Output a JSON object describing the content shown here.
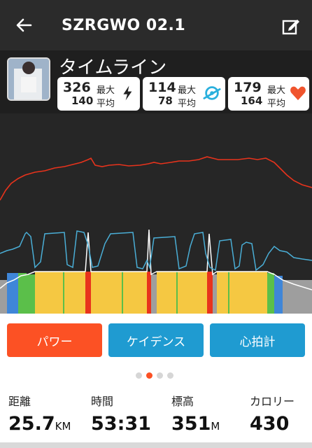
{
  "header": {
    "title": "SZRGWO 02.1"
  },
  "summary": {
    "title": "タイムライン",
    "stats": [
      {
        "max": "326",
        "avg": "140",
        "max_label": "最大",
        "avg_label": "平均",
        "icon": "lightning-icon",
        "color": "#222222"
      },
      {
        "max": "114",
        "avg": "78",
        "max_label": "最大",
        "avg_label": "平均",
        "icon": "cadence-icon",
        "color": "#2ab0dd"
      },
      {
        "max": "179",
        "avg": "164",
        "max_label": "最大",
        "avg_label": "平均",
        "icon": "heart-icon",
        "color": "#f0542d"
      }
    ]
  },
  "tabs": [
    {
      "label": "パワー",
      "color": "#fc5124"
    },
    {
      "label": "ケイデンス",
      "color": "#1f9bd1"
    },
    {
      "label": "心拍計",
      "color": "#1f9bd1"
    }
  ],
  "pager": {
    "active": 1,
    "count": 4
  },
  "metrics": [
    {
      "label": "距離",
      "value": "25.7",
      "unit": "KM"
    },
    {
      "label": "時間",
      "value": "53:31",
      "unit": ""
    },
    {
      "label": "標高",
      "value": "351",
      "unit": "M"
    },
    {
      "label": "カロリー",
      "value": "430",
      "unit": ""
    }
  ],
  "colors": {
    "heart_rate_line": "#e8331c",
    "cadence_line": "#4aaed6",
    "power_fill": "#f5c842"
  }
}
